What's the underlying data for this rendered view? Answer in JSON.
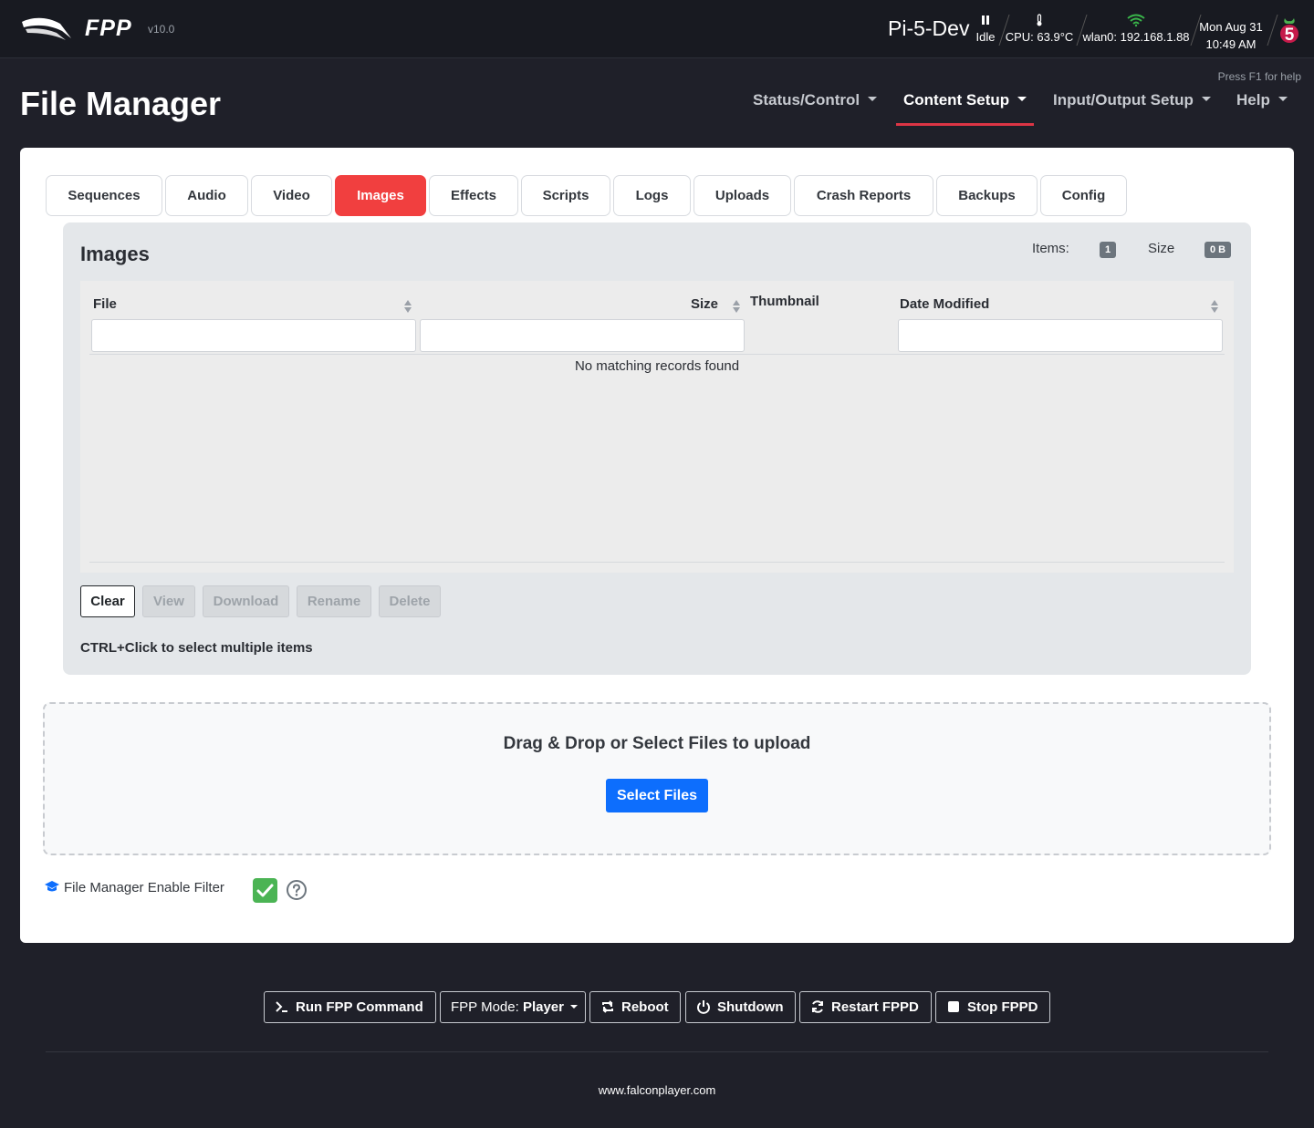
{
  "app": {
    "brand": "FPP",
    "version": "v10.0",
    "hostname": "Pi-5-Dev",
    "status": "Idle",
    "cpu": "CPU: 63.9°C",
    "network": "wlan0: 192.168.1.88",
    "date": "Mon Aug 31",
    "time": "10:49 AM",
    "board_badge": "5"
  },
  "header": {
    "help_hint": "Press F1 for help",
    "title": "File Manager",
    "nav": [
      "Status/Control",
      "Content Setup",
      "Input/Output Setup",
      "Help"
    ],
    "active_nav": "Content Setup"
  },
  "tabs": [
    "Sequences",
    "Audio",
    "Video",
    "Images",
    "Effects",
    "Scripts",
    "Logs",
    "Uploads",
    "Crash Reports",
    "Backups",
    "Config"
  ],
  "active_tab": "Images",
  "panel": {
    "title": "Images",
    "items_label": "Items:",
    "items_count": "1",
    "size_label": "Size",
    "size_value": "0 B",
    "columns": [
      "File",
      "Size",
      "Thumbnail",
      "Date Modified"
    ],
    "empty_message": "No matching records found",
    "buttons": [
      "Clear",
      "View",
      "Download",
      "Rename",
      "Delete"
    ],
    "hint": "CTRL+Click to select multiple items"
  },
  "upload": {
    "title": "Drag & Drop or Select Files to upload",
    "button": "Select Files"
  },
  "setting": {
    "label": "File Manager Enable Filter",
    "checked": true
  },
  "footer": {
    "run_command": "Run FPP Command",
    "mode_label": "FPP Mode:",
    "mode_value": "Player",
    "reboot": "Reboot",
    "shutdown": "Shutdown",
    "restart": "Restart FPPD",
    "stop": "Stop FPPD",
    "link": "www.falconplayer.com"
  },
  "colors": {
    "accent_red": "#f13f3f",
    "primary_blue": "#0d6efd",
    "check_green": "#4bb454",
    "dark_bg": "#1f2029"
  }
}
